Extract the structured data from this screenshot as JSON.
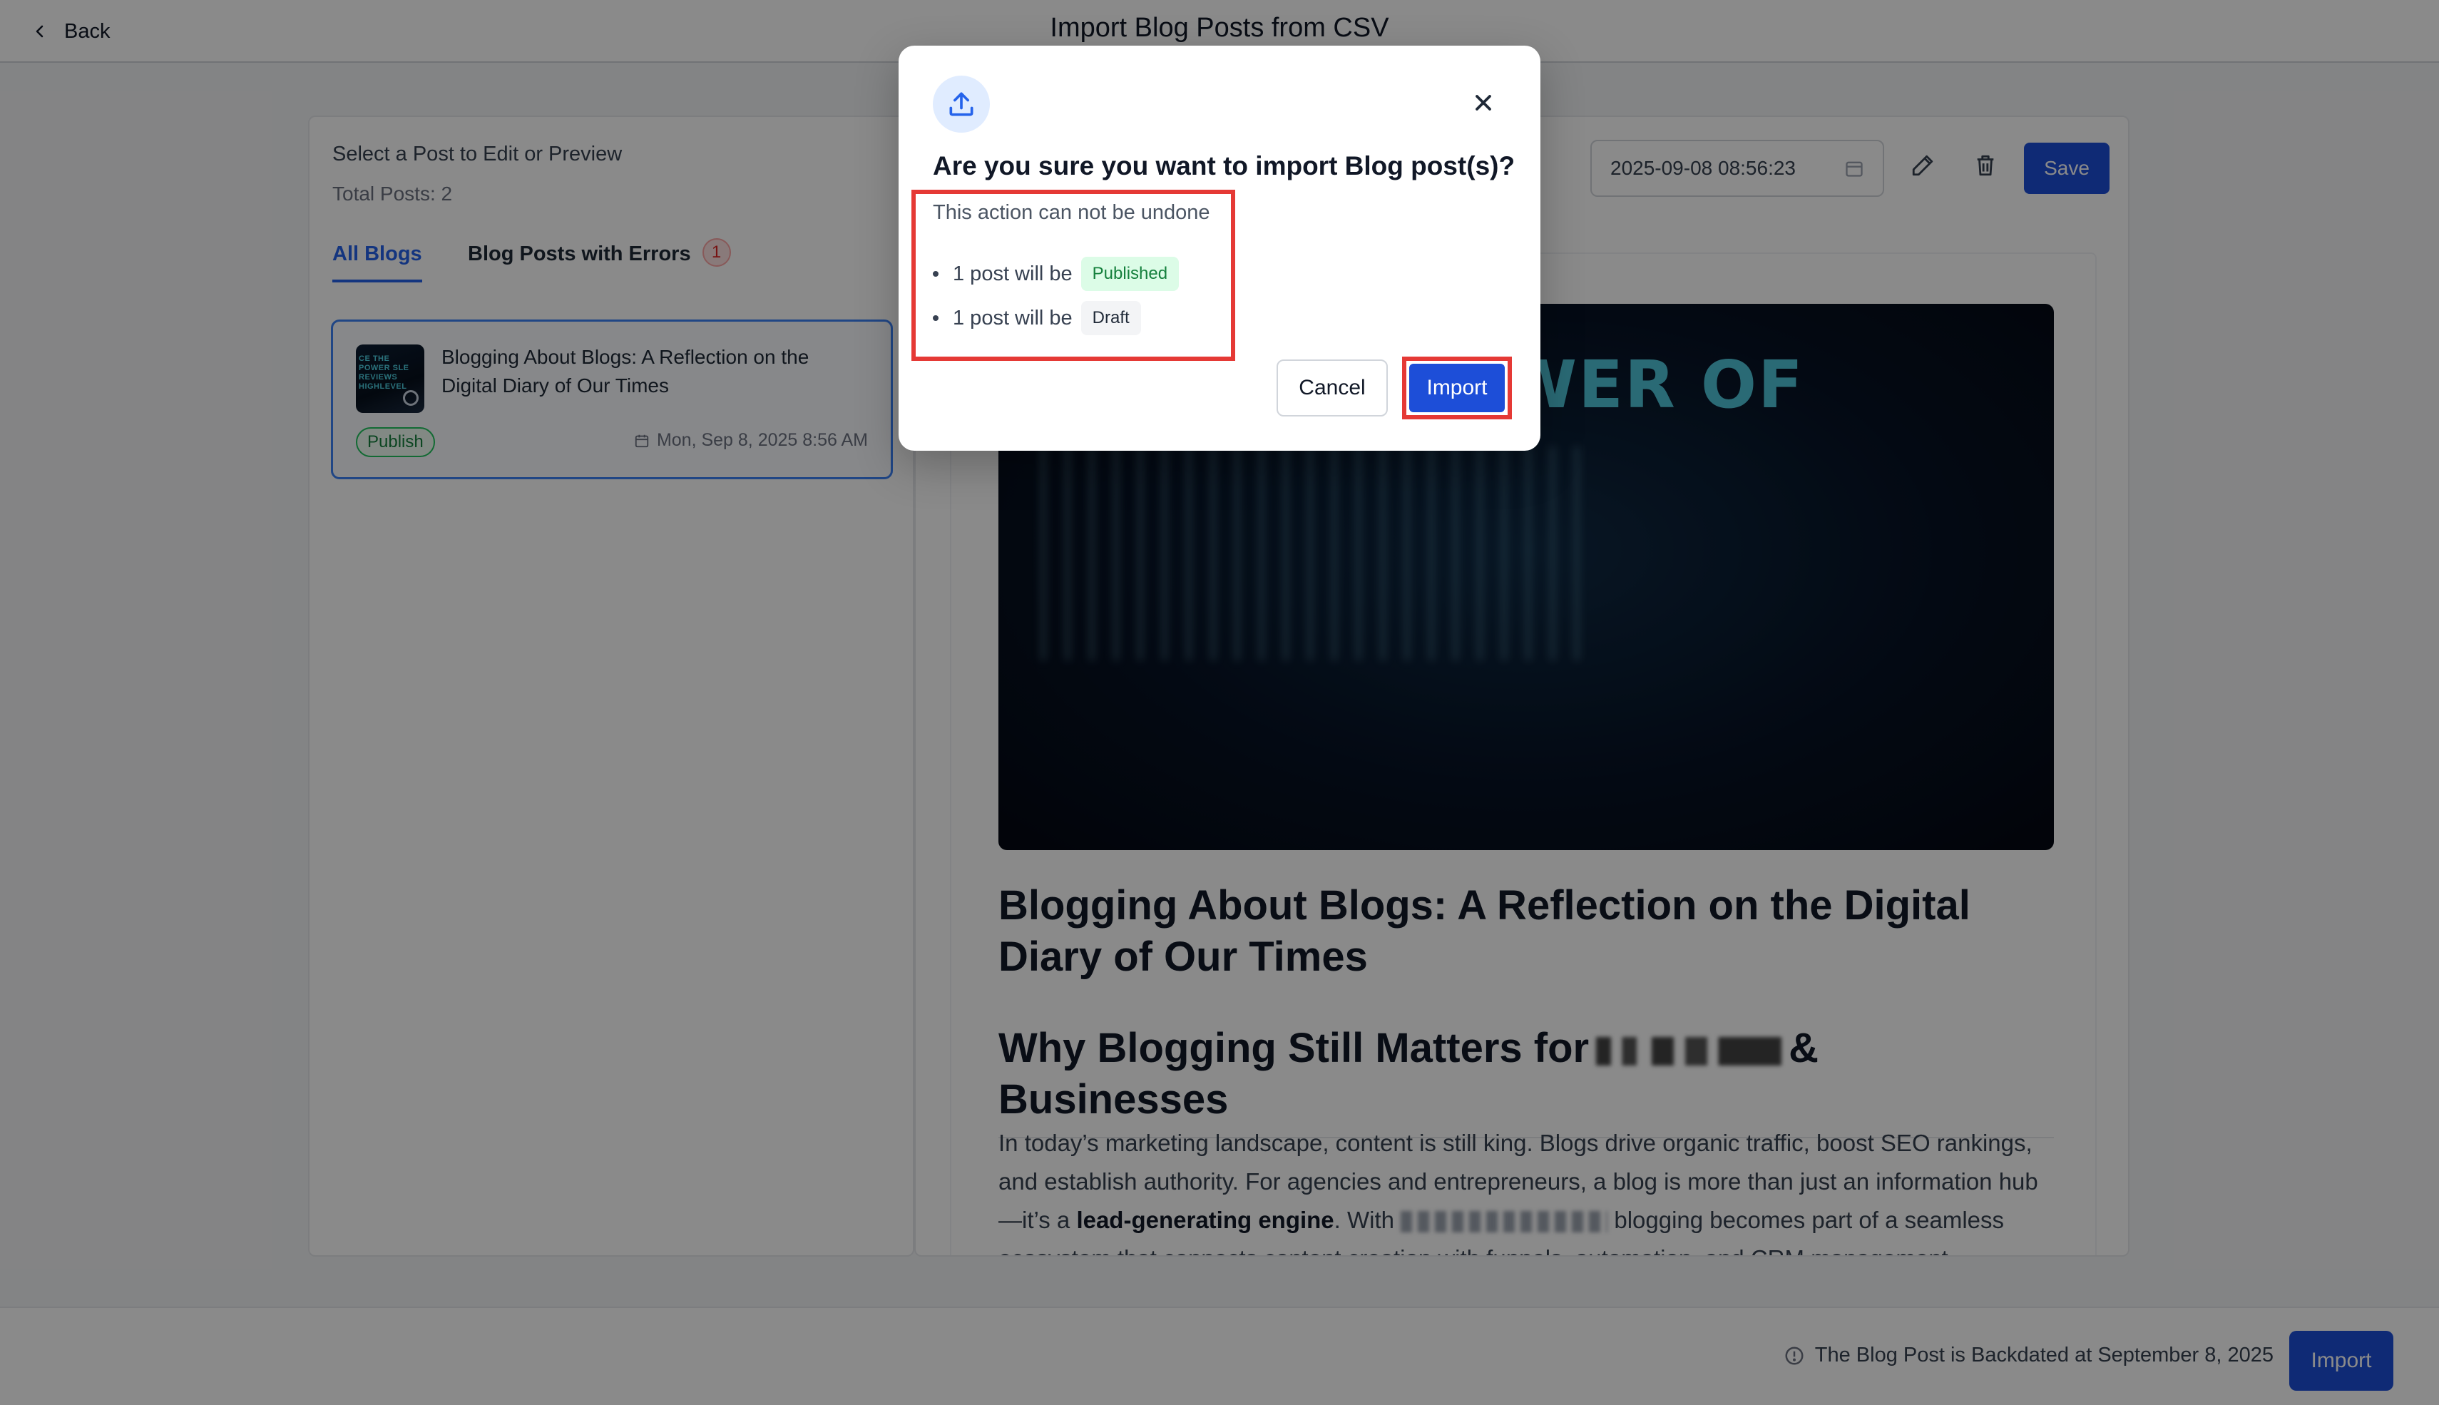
{
  "topbar": {
    "back_label": "Back",
    "title": "Import Blog Posts from CSV"
  },
  "sidebar": {
    "heading": "Select a Post to Edit or Preview",
    "total": "Total Posts: 2",
    "tabs": [
      {
        "label": "All Blogs"
      },
      {
        "label": "Blog Posts with Errors",
        "badge": "1"
      }
    ],
    "posts": [
      {
        "title": "Blogging About Blogs: A Reflection on the Digital Diary of Our Times",
        "status": "Publish",
        "date": "Mon, Sep 8, 2025 8:56 AM",
        "thumb_text": "CE THE POWER SLE REVIEWS HIGHLEVEL"
      }
    ]
  },
  "editor": {
    "datetime_value": "2025-09-08 08:56:23",
    "save_label": "Save",
    "hero_text": "POWER OF",
    "article_title": "Blogging About Blogs: A Reflection on the Digital Diary of Our Times",
    "h2_prefix": "Why Blogging Still Matters for",
    "h2_suffix": "& Businesses",
    "paragraph": {
      "part1": "In today’s marketing landscape, content is still king. Blogs drive organic traffic, boost SEO rankings, and establish authority. For agencies and entrepreneurs, a blog is more than just an information hub—it’s a ",
      "bold": "lead-generating engine",
      "part2": ". With ",
      "part3": " blogging becomes part of a seamless ecosystem that connects content creation with funnels, automation, and CRM management."
    }
  },
  "footer": {
    "note": "The Blog Post is Backdated at September 8, 2025",
    "import_label": "Import"
  },
  "modal": {
    "title": "Are you sure you want to import Blog post(s)?",
    "subtitle": "This action can not be undone",
    "items": [
      {
        "text": "1 post will be",
        "status": "Published"
      },
      {
        "text": "1 post will be",
        "status": "Draft"
      }
    ],
    "cancel_label": "Cancel",
    "import_label": "Import"
  },
  "colors": {
    "accent": "#1d4ed8",
    "highlight": "#e53935",
    "published_bg": "#dcfce7",
    "published_text": "#15803d"
  }
}
